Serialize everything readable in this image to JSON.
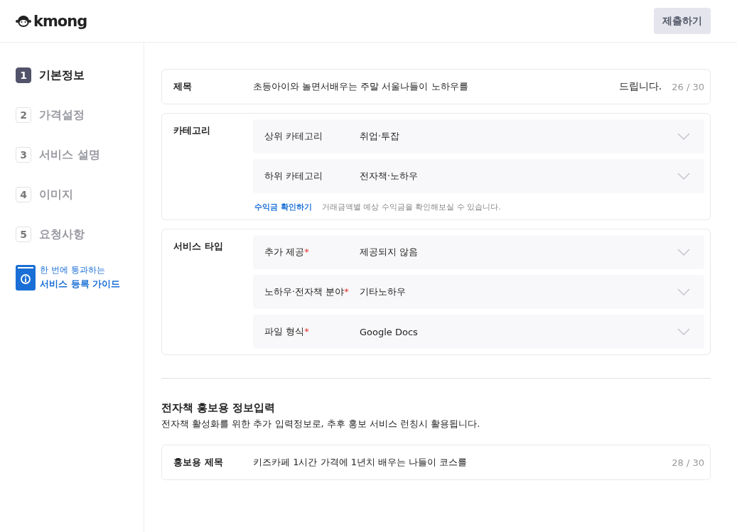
{
  "header": {
    "logo": "kmong",
    "submit_button": "제출하기"
  },
  "steps": [
    {
      "number": "1",
      "label": "기본정보",
      "selected": true
    },
    {
      "number": "2",
      "label": "가격설정",
      "selected": false
    },
    {
      "number": "3",
      "label": "서비스 설명",
      "selected": false
    },
    {
      "number": "4",
      "label": "이미지",
      "selected": false
    },
    {
      "number": "5",
      "label": "요청사항",
      "selected": false
    }
  ],
  "guide": {
    "line_1": "한 번에 통과하는",
    "line_2": "서비스 등록 가이드"
  },
  "title_field": {
    "label": "제목",
    "value": "초등아이와 놀면서배우는 주말 서울나들이 노하우를",
    "suffix": "드립니다.",
    "counter": "26 / 30"
  },
  "category": {
    "label": "카테고리",
    "selects": [
      {
        "label": "상위 카테고리",
        "value": "취업·투잡"
      },
      {
        "label": "하위 카테고리",
        "value": "전자책·노하우"
      }
    ],
    "link": "수익금 확인하기",
    "hint": "거래금액별 예상 수익금을 확인해보실 수 있습니다."
  },
  "service_type": {
    "label": "서비스 타입",
    "selects": [
      {
        "label": "추가 제공",
        "required_mark": "*",
        "value": "제공되지 않음"
      },
      {
        "label": "노하우·전자책 분야",
        "required_mark": "*",
        "value": "기타노하우"
      },
      {
        "label": "파일 형식",
        "required_mark": "*",
        "value": "Google Docs"
      }
    ]
  },
  "promo": {
    "heading": "전자책 홍보용 정보입력",
    "description": "전자책 활성화를 위한 추가 입력정보로, 추후 홍보 서비스 런칭시 활용됩니다.",
    "label": "홍보용 제목",
    "value": "키즈카페 1시간 가격에 1년치 배우는 나들이 코스를",
    "counter": "28 / 30"
  }
}
